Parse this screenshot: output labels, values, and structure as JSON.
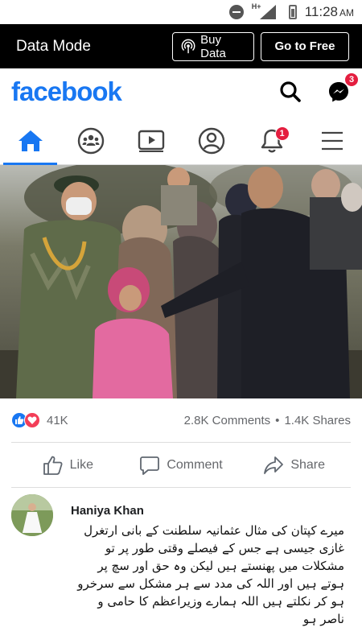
{
  "status_bar": {
    "network": "H+",
    "time": "11:28",
    "ampm": "AM"
  },
  "data_mode_bar": {
    "title": "Data Mode",
    "buy_label": "Buy Data",
    "free_label": "Go to Free"
  },
  "header": {
    "logo": "facebook",
    "messenger_badge": "3"
  },
  "tabs": [
    {
      "name": "home",
      "icon": "home-icon",
      "active": true
    },
    {
      "name": "groups",
      "icon": "groups-icon"
    },
    {
      "name": "watch",
      "icon": "video-icon"
    },
    {
      "name": "profile",
      "icon": "profile-icon"
    },
    {
      "name": "notifications",
      "icon": "bell-icon",
      "badge": "1"
    },
    {
      "name": "menu",
      "icon": "hamburger-menu-icon"
    }
  ],
  "post": {
    "reaction_count": "41K",
    "comments": "2.8K Comments",
    "shares": "1.4K Shares",
    "actions": {
      "like": "Like",
      "comment": "Comment",
      "share": "Share"
    }
  },
  "comment": {
    "author": "Haniya Khan",
    "text": "میرے کپتان کی مثال عثمانیہ سلطنت کے بانی ارتغرل غازی جیسی ہے جس کے فیصلے وقتی طور پر تو مشکلات میں پھنستے ہیں لیکن وہ حق اور سچ پر ہوتے ہیں اور اللہ کی مدد سے ہر مشکل سے سرخرو ہو کر نکلتے ہیں اللہ ہمارے وزیراعظم کا حامی و ناصر ہو"
  },
  "colors": {
    "brand": "#1877f2",
    "badge": "#e41e3f",
    "love": "#f33e58"
  }
}
